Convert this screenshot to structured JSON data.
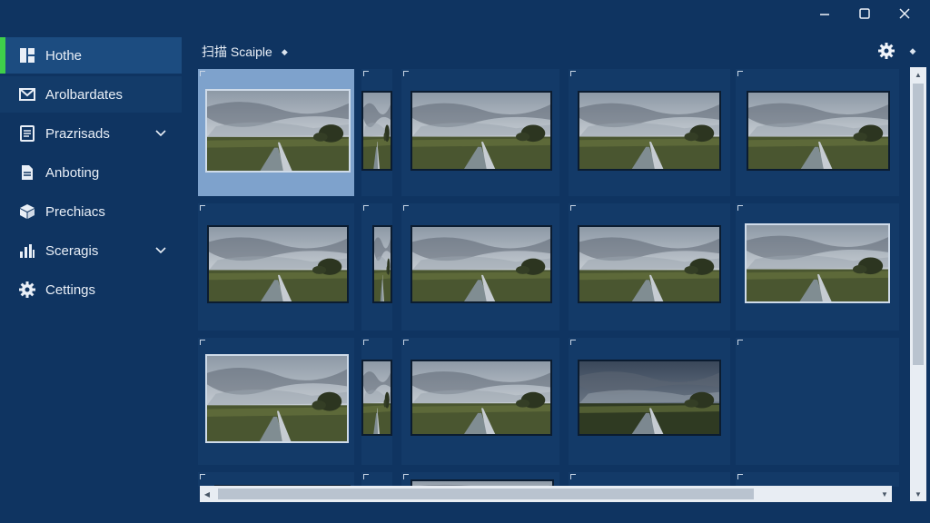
{
  "window": {
    "minimize_label": "—",
    "maximize_label": "☐",
    "close_label": "✕"
  },
  "sidebar": {
    "items": [
      {
        "label": "Hothe",
        "icon": "home-icon",
        "active": true
      },
      {
        "label": "Arolbardates",
        "icon": "mail-icon"
      },
      {
        "label": "Prazrisads",
        "icon": "document-icon",
        "expandable": true
      },
      {
        "label": "Anboting",
        "icon": "file-icon"
      },
      {
        "label": "Prechiacs",
        "icon": "box-icon"
      },
      {
        "label": "Sceragis",
        "icon": "bar-chart-icon",
        "expandable": true
      },
      {
        "label": "Cettings",
        "icon": "gear-icon"
      }
    ]
  },
  "header": {
    "breadcrumb": "扫描 Scaiple",
    "breadcrumb_arrow": "◆"
  },
  "gallery": {
    "selected_index": 0,
    "thumbnail_subject": "cloudy marsh landscape with boardwalk",
    "count": 16
  },
  "colors": {
    "background": "#0f3461",
    "active_item": "#1c4c80",
    "accent": "#3fcf4a",
    "selected_cell": "#7ea2cc",
    "cell": "#133a68"
  }
}
